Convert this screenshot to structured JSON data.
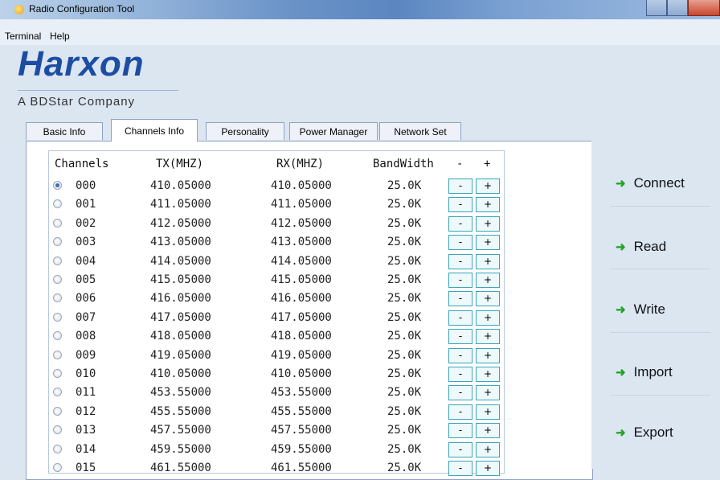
{
  "window": {
    "title": "Radio Configuration Tool"
  },
  "menu": {
    "items": [
      "Terminal",
      "Help"
    ]
  },
  "brand": {
    "logo": "Harxon",
    "tagline": "A BDStar Company"
  },
  "tabs": [
    {
      "label": "Basic Info",
      "active": false
    },
    {
      "label": "Channels Info",
      "active": true
    },
    {
      "label": "Personality",
      "active": false
    },
    {
      "label": "Power Manager",
      "active": false
    },
    {
      "label": "Network Set",
      "active": false
    }
  ],
  "table": {
    "headers": {
      "channels": "Channels",
      "tx": "TX(MHZ)",
      "rx": "RX(MHZ)",
      "bandwidth": "BandWidth",
      "minus": "-",
      "plus": "+"
    },
    "button_minus": "-",
    "button_plus": "+",
    "selected_index": 0,
    "rows": [
      {
        "ch": "000",
        "tx": "410.05000",
        "rx": "410.05000",
        "bw": "25.0K"
      },
      {
        "ch": "001",
        "tx": "411.05000",
        "rx": "411.05000",
        "bw": "25.0K"
      },
      {
        "ch": "002",
        "tx": "412.05000",
        "rx": "412.05000",
        "bw": "25.0K"
      },
      {
        "ch": "003",
        "tx": "413.05000",
        "rx": "413.05000",
        "bw": "25.0K"
      },
      {
        "ch": "004",
        "tx": "414.05000",
        "rx": "414.05000",
        "bw": "25.0K"
      },
      {
        "ch": "005",
        "tx": "415.05000",
        "rx": "415.05000",
        "bw": "25.0K"
      },
      {
        "ch": "006",
        "tx": "416.05000",
        "rx": "416.05000",
        "bw": "25.0K"
      },
      {
        "ch": "007",
        "tx": "417.05000",
        "rx": "417.05000",
        "bw": "25.0K"
      },
      {
        "ch": "008",
        "tx": "418.05000",
        "rx": "418.05000",
        "bw": "25.0K"
      },
      {
        "ch": "009",
        "tx": "419.05000",
        "rx": "419.05000",
        "bw": "25.0K"
      },
      {
        "ch": "010",
        "tx": "410.05000",
        "rx": "410.05000",
        "bw": "25.0K"
      },
      {
        "ch": "011",
        "tx": "453.55000",
        "rx": "453.55000",
        "bw": "25.0K"
      },
      {
        "ch": "012",
        "tx": "455.55000",
        "rx": "455.55000",
        "bw": "25.0K"
      },
      {
        "ch": "013",
        "tx": "457.55000",
        "rx": "457.55000",
        "bw": "25.0K"
      },
      {
        "ch": "014",
        "tx": "459.55000",
        "rx": "459.55000",
        "bw": "25.0K"
      },
      {
        "ch": "015",
        "tx": "461.55000",
        "rx": "461.55000",
        "bw": "25.0K"
      }
    ]
  },
  "actions": [
    "Connect",
    "Read",
    "Write",
    "Import",
    "Export"
  ],
  "colors": {
    "accent": "#1d4da3",
    "arrow": "#27a327",
    "button_border": "#3aa4b8"
  }
}
